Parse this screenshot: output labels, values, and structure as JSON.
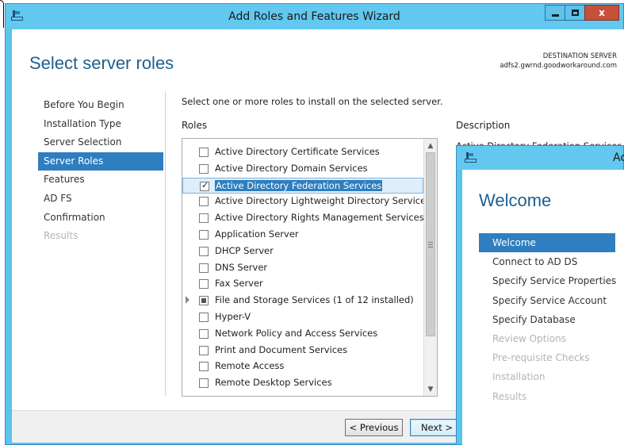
{
  "main_window": {
    "title": "Add Roles and Features Wizard",
    "page_title": "Select server roles",
    "destination_label": "DESTINATION SERVER",
    "destination_server": "adfs2.gwrnd.goodworkaround.com",
    "controls": {
      "minimize": "_",
      "close": "x"
    },
    "nav": [
      {
        "label": "Before You Begin",
        "state": "normal"
      },
      {
        "label": "Installation Type",
        "state": "normal"
      },
      {
        "label": "Server Selection",
        "state": "normal"
      },
      {
        "label": "Server Roles",
        "state": "active"
      },
      {
        "label": "Features",
        "state": "normal"
      },
      {
        "label": "AD FS",
        "state": "normal"
      },
      {
        "label": "Confirmation",
        "state": "normal"
      },
      {
        "label": "Results",
        "state": "disabled"
      }
    ],
    "instruction": "Select one or more roles to install on the selected server.",
    "roles_header": "Roles",
    "roles": [
      {
        "label": "Active Directory Certificate Services",
        "checked": false,
        "selected": false
      },
      {
        "label": "Active Directory Domain Services",
        "checked": false,
        "selected": false
      },
      {
        "label": "Active Directory Federation Services",
        "checked": true,
        "selected": true
      },
      {
        "label": "Active Directory Lightweight Directory Services",
        "checked": false,
        "selected": false
      },
      {
        "label": "Active Directory Rights Management Services",
        "checked": false,
        "selected": false
      },
      {
        "label": "Application Server",
        "checked": false,
        "selected": false
      },
      {
        "label": "DHCP Server",
        "checked": false,
        "selected": false
      },
      {
        "label": "DNS Server",
        "checked": false,
        "selected": false
      },
      {
        "label": "Fax Server",
        "checked": false,
        "selected": false
      },
      {
        "label": "File and Storage Services (1 of 12 installed)",
        "checked": "partial",
        "selected": false,
        "expandable": true
      },
      {
        "label": "Hyper-V",
        "checked": false,
        "selected": false
      },
      {
        "label": "Network Policy and Access Services",
        "checked": false,
        "selected": false
      },
      {
        "label": "Print and Document Services",
        "checked": false,
        "selected": false
      },
      {
        "label": "Remote Access",
        "checked": false,
        "selected": false
      },
      {
        "label": "Remote Desktop Services",
        "checked": false,
        "selected": false
      }
    ],
    "description_header": "Description",
    "description_text": "Active Directory Federation Services",
    "buttons": {
      "previous": "< Previous",
      "next": "Next >"
    }
  },
  "adfs_window": {
    "title_fragment": "Ac",
    "page_title": "Welcome",
    "nav": [
      {
        "label": "Welcome",
        "state": "active"
      },
      {
        "label": "Connect to AD DS",
        "state": "normal"
      },
      {
        "label": "Specify Service Properties",
        "state": "normal"
      },
      {
        "label": "Specify Service Account",
        "state": "normal"
      },
      {
        "label": "Specify Database",
        "state": "normal"
      },
      {
        "label": "Review Options",
        "state": "disabled"
      },
      {
        "label": "Pre-requisite Checks",
        "state": "disabled"
      },
      {
        "label": "Installation",
        "state": "disabled"
      },
      {
        "label": "Results",
        "state": "disabled"
      }
    ]
  },
  "colors": {
    "title_bar": "#62c8ef",
    "accent": "#2e7ec0",
    "heading": "#1f5f8e",
    "close_button": "#c7503a"
  }
}
